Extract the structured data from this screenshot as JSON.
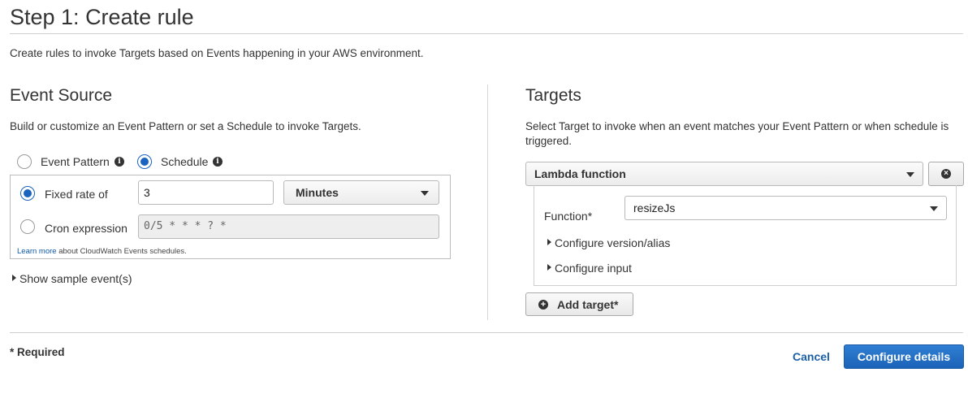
{
  "header": {
    "title": "Step 1: Create rule",
    "intro": "Create rules to invoke Targets based on Events happening in your AWS environment."
  },
  "event_source": {
    "title": "Event Source",
    "description": "Build or customize an Event Pattern or set a Schedule to invoke Targets.",
    "options": {
      "event_pattern": "Event Pattern",
      "schedule": "Schedule",
      "selected": "schedule"
    },
    "schedule": {
      "fixed_rate_label": "Fixed rate of",
      "fixed_rate_value": "3",
      "unit": "Minutes",
      "cron_label": "Cron expression",
      "cron_placeholder": "0/5 * * * ? *",
      "selected": "fixed_rate",
      "learn_more_link": "Learn more",
      "learn_more_rest": " about CloudWatch Events schedules."
    },
    "show_sample": "Show sample event(s)"
  },
  "targets": {
    "title": "Targets",
    "description": "Select Target to invoke when an event matches your Event Pattern or when schedule is triggered.",
    "target_type": "Lambda function",
    "function_label": "Function*",
    "function_value": "resizeJs",
    "configure_version": "Configure version/alias",
    "configure_input": "Configure input",
    "add_target": "Add target*"
  },
  "footer": {
    "required_note": "* Required",
    "cancel": "Cancel",
    "configure_details": "Configure details"
  },
  "icons": {
    "info": "info-icon",
    "remove": "remove-target-icon",
    "add": "add-icon",
    "expand": "expand-triangle-icon",
    "dropdown": "chevron-down-icon"
  },
  "colors": {
    "primary_button": "#1b63b8",
    "link": "#0e5aa7",
    "radio_selected": "#1a64c0"
  }
}
